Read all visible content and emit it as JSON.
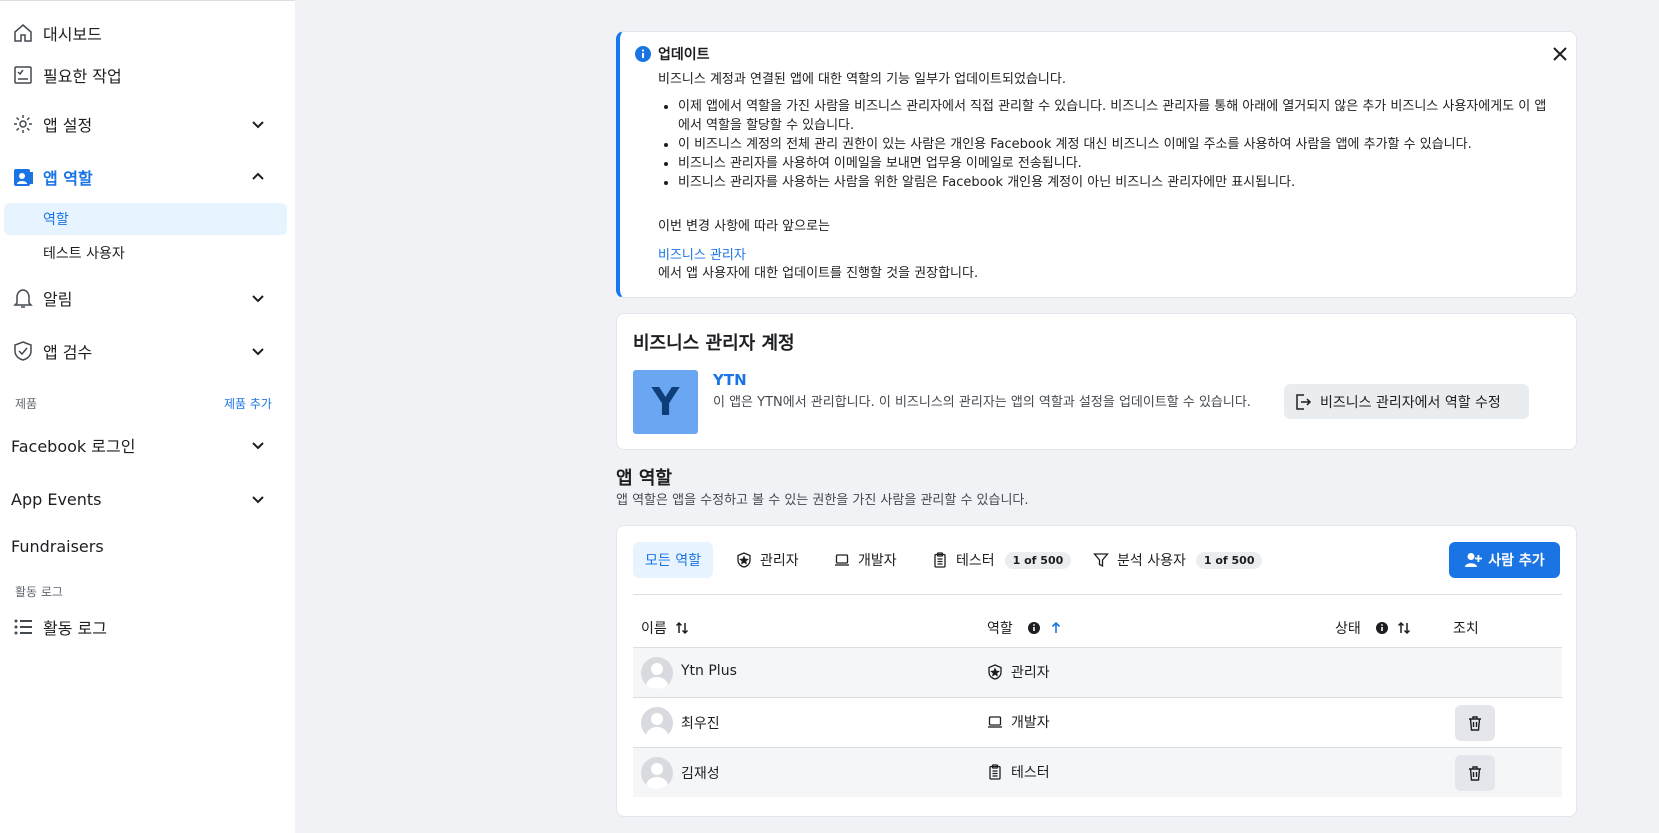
{
  "sidebar": {
    "dashboard": "대시보드",
    "required_actions": "필요한 작업",
    "app_settings": "앱 설정",
    "app_roles": "앱 역할",
    "roles": "역할",
    "test_users": "테스트 사용자",
    "alerts": "알림",
    "app_review": "앱 검수",
    "products_label": "제품",
    "add_product": "제품 추가",
    "facebook_login": "Facebook 로그인",
    "app_events": "App Events",
    "fundraisers": "Fundraisers",
    "activity_log_label": "활동 로그",
    "activity_log": "활동 로그"
  },
  "notice": {
    "title": "업데이트",
    "intro": "비즈니스 계정과 연결된 앱에 대한 역할의 기능 일부가 업데이트되었습니다.",
    "bullets": [
      "이제 앱에서 역할을 가진 사람을 비즈니스 관리자에서 직접 관리할 수 있습니다. 비즈니스 관리자를 통해 아래에 열거되지 않은 추가 비즈니스 사용자에게도 이 앱에서 역할을 할당할 수 있습니다.",
      "이 비즈니스 계정의 전체 관리 권한이 있는 사람은 개인용 Facebook 계정 대신 비즈니스 이메일 주소를 사용하여 사람을 앱에 추가할 수 있습니다.",
      "비즈니스 관리자를 사용하여 이메일을 보내면 업무용 이메일로 전송됩니다.",
      "비즈니스 관리자를 사용하는 사람을 위한 알림은 Facebook 개인용 계정이 아닌 비즈니스 관리자에만 표시됩니다."
    ],
    "after_list": "이번 변경 사항에 따라 앞으로는",
    "link": "비즈니스 관리자",
    "closing": "에서 앱 사용자에 대한 업데이트를 진행할 것을 권장합니다."
  },
  "business": {
    "heading": "비즈니스 관리자 계정",
    "logo_letter": "Y",
    "name": "YTN",
    "description": "이 앱은 YTN에서 관리합니다. 이 비즈니스의 관리자는 앱의 역할과 설정을 업데이트할 수 있습니다.",
    "edit_button": "비즈니스 관리자에서 역할 수정"
  },
  "roles": {
    "title": "앱 역할",
    "subtitle": "앱 역할은 앱을 수정하고 볼 수 있는 권한을 가진 사람을 관리할 수 있습니다.",
    "tabs": {
      "all": "모든 역할",
      "admin": "관리자",
      "developer": "개발자",
      "tester": "테스터",
      "tester_count": "1 of 500",
      "analytics": "분석 사용자",
      "analytics_count": "1 of 500"
    },
    "add_button": "사람 추가",
    "columns": {
      "name": "이름",
      "role": "역할",
      "status": "상태",
      "actions": "조치"
    },
    "rows": [
      {
        "name": "Ytn Plus",
        "role": "관리자"
      },
      {
        "name": "최우진",
        "role": "개발자"
      },
      {
        "name": "김재성",
        "role": "테스터"
      }
    ]
  }
}
